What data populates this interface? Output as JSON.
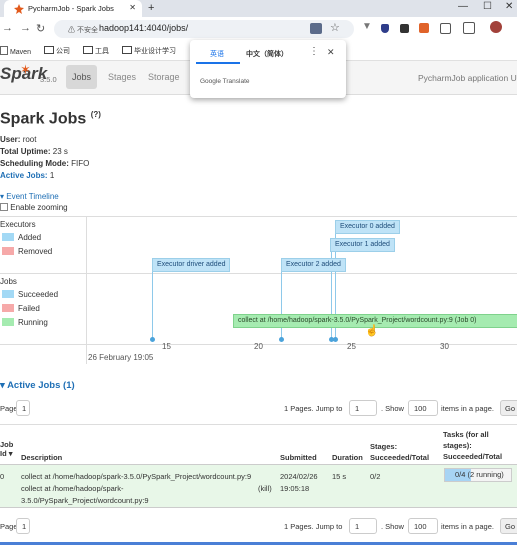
{
  "browser": {
    "tab_title": "PycharmJob - Spark Jobs",
    "new_tab": "+",
    "security": "不安全",
    "url": "hadoop141:4040/jobs/",
    "bookmarks": [
      "Maven",
      "公司",
      "工具",
      "毕业设计学习"
    ]
  },
  "translate_popup": {
    "lang_english": "英语",
    "lang_chinese": "中文（简体）",
    "footer": "Google Translate"
  },
  "spark_nav": {
    "logo": "Spark",
    "version": "3.5.0",
    "tabs": [
      "Jobs",
      "Stages",
      "Storage"
    ],
    "app_name": "PycharmJob application UI"
  },
  "summary": {
    "title": "Spark Jobs",
    "help": "(?)",
    "user_label": "User:",
    "user": "root",
    "uptime_label": "Total Uptime:",
    "uptime": "23 s",
    "mode_label": "Scheduling Mode:",
    "mode": "FIFO",
    "active_label": "Active Jobs:",
    "active": "1"
  },
  "timeline": {
    "toggle": "Event Timeline",
    "zoom_label": "Enable zooming",
    "executors_label": "Executors",
    "legend_added": "Added",
    "legend_removed": "Removed",
    "jobs_label": "Jobs",
    "legend_succeeded": "Succeeded",
    "legend_failed": "Failed",
    "legend_running": "Running",
    "events": [
      "Executor driver added",
      "Executor 2 added",
      "Executor 1 added",
      "Executor 0 added"
    ],
    "job_bar": "collect at /home/hadoop/spark-3.5.0/PySpark_Project/wordcount.py:9 (Job 0)",
    "ticks": [
      "15",
      "20",
      "25",
      "30"
    ],
    "date_label": "26 February 19:05",
    "colors": {
      "added": "#a3d9f5",
      "removed": "#f6a9a9",
      "succeeded": "#a3d9f5",
      "failed": "#f6a9a9",
      "running": "#a5ebb0"
    }
  },
  "active_jobs": {
    "heading": "Active Jobs (1)",
    "page_label": "Page:",
    "page_value": "1",
    "pages_text": "1 Pages. Jump to",
    "jump_value": "1",
    "show_label": ". Show",
    "show_value": "100",
    "items_text": "items in a page.",
    "go": "Go",
    "headers": {
      "job_id": "Job Id ▾",
      "description": "Description",
      "submitted": "Submitted",
      "duration": "Duration",
      "stages": "Stages: Succeeded/Total",
      "tasks": "Tasks (for all stages): Succeeded/Total"
    },
    "rows": [
      {
        "job_id": "0",
        "desc_main": "collect at /home/hadoop/spark-3.5.0/PySpark_Project/wordcount.py:9",
        "desc_link_1": "collect at /home/hadoop/spark-",
        "desc_link_2": "3.5.0/PySpark_Project/wordcount.py:9",
        "kill": "(kill)",
        "submitted_date": "2024/02/26",
        "submitted_time": "19:05:18",
        "duration": "15 s",
        "stages": "0/2",
        "tasks": "0/4",
        "tasks_running": "(2 running)",
        "tasks_progress": 0.4
      }
    ]
  }
}
